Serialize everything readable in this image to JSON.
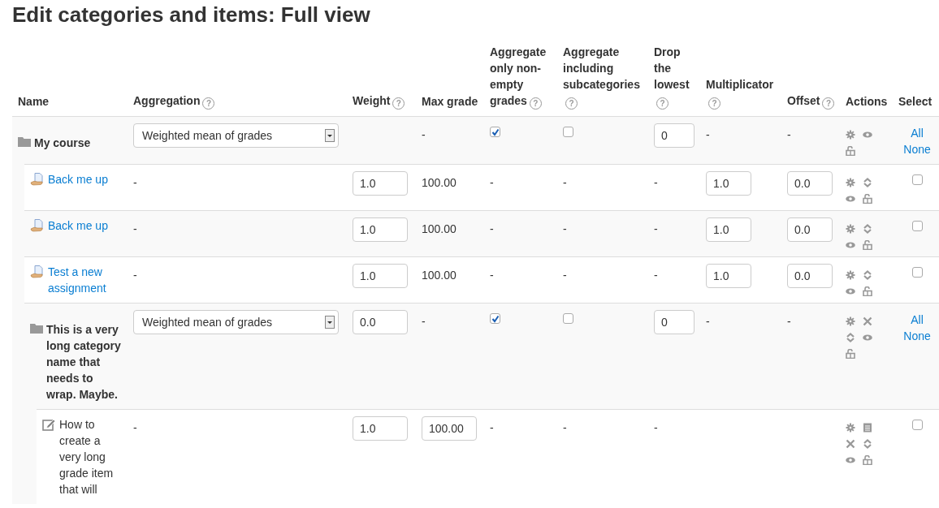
{
  "title": "Edit categories and items: Full view",
  "columns": [
    {
      "label": "Name"
    },
    {
      "label": "Aggregation",
      "help": "?"
    },
    {
      "label": "Weight",
      "help": "?"
    },
    {
      "label": "Max grade"
    },
    {
      "label": "Aggregate only non-empty grades",
      "help": "?"
    },
    {
      "label": "Aggregate including subcategories",
      "help": "?"
    },
    {
      "label": "Drop the lowest",
      "help": "?"
    },
    {
      "label": "Multiplicator",
      "help": "?"
    },
    {
      "label": "Offset",
      "help": "?"
    },
    {
      "label": "Actions"
    },
    {
      "label": "Select"
    }
  ],
  "rows": [
    {
      "kind": "category",
      "name": "My course",
      "cells": [
        {
          "kind": "select",
          "value": "Weighted mean of grades"
        },
        null,
        {
          "kind": "text",
          "text": "-"
        },
        {
          "kind": "checkbox",
          "checked": true
        },
        {
          "kind": "checkbox",
          "checked": false
        },
        {
          "kind": "field",
          "value": "0"
        },
        {
          "kind": "text",
          "text": "-"
        },
        {
          "kind": "text",
          "text": "-"
        }
      ],
      "actions": [
        {
          "kind": "settings"
        },
        {
          "kind": "hide"
        },
        {
          "kind": "lock"
        }
      ],
      "select": {
        "kind": "links",
        "links": [
          "All",
          "None"
        ]
      },
      "children": [
        {
          "kind": "assignment",
          "name": "Back me up",
          "cells": [
            {
              "kind": "text",
              "text": "-"
            },
            {
              "kind": "field",
              "value": "1.0"
            },
            {
              "kind": "text",
              "text": "100.00"
            },
            {
              "kind": "text",
              "text": "-"
            },
            {
              "kind": "text",
              "text": "-"
            },
            {
              "kind": "text",
              "text": "-"
            },
            {
              "kind": "field",
              "value": "1.0"
            },
            {
              "kind": "field",
              "value": "0.0"
            }
          ],
          "actions": [
            {
              "kind": "settings"
            },
            {
              "kind": "move"
            },
            {
              "kind": "hide"
            },
            {
              "kind": "lock"
            }
          ],
          "select": {
            "kind": "checkbox",
            "checked": false
          }
        },
        {
          "kind": "assignment",
          "name": "Back me up",
          "cells": [
            {
              "kind": "text",
              "text": "-"
            },
            {
              "kind": "field",
              "value": "1.0"
            },
            {
              "kind": "text",
              "text": "100.00"
            },
            {
              "kind": "text",
              "text": "-"
            },
            {
              "kind": "text",
              "text": "-"
            },
            {
              "kind": "text",
              "text": "-"
            },
            {
              "kind": "field",
              "value": "1.0"
            },
            {
              "kind": "field",
              "value": "0.0"
            }
          ],
          "actions": [
            {
              "kind": "settings"
            },
            {
              "kind": "move"
            },
            {
              "kind": "hide"
            },
            {
              "kind": "lock"
            }
          ],
          "select": {
            "kind": "checkbox",
            "checked": false
          }
        },
        {
          "kind": "assignment",
          "name": "Test a new assignment",
          "cells": [
            {
              "kind": "text",
              "text": "-"
            },
            {
              "kind": "field",
              "value": "1.0"
            },
            {
              "kind": "text",
              "text": "100.00"
            },
            {
              "kind": "text",
              "text": "-"
            },
            {
              "kind": "text",
              "text": "-"
            },
            {
              "kind": "text",
              "text": "-"
            },
            {
              "kind": "field",
              "value": "1.0"
            },
            {
              "kind": "field",
              "value": "0.0"
            }
          ],
          "actions": [
            {
              "kind": "settings"
            },
            {
              "kind": "move"
            },
            {
              "kind": "hide"
            },
            {
              "kind": "lock"
            }
          ],
          "select": {
            "kind": "checkbox",
            "checked": false
          }
        },
        {
          "kind": "category",
          "name": "This is a very long category name that needs to wrap. Maybe.",
          "cells": [
            {
              "kind": "select",
              "value": "Weighted mean of grades"
            },
            {
              "kind": "field",
              "value": "0.0"
            },
            {
              "kind": "text",
              "text": "-"
            },
            {
              "kind": "checkbox",
              "checked": true
            },
            {
              "kind": "checkbox",
              "checked": false
            },
            {
              "kind": "field",
              "value": "0"
            },
            {
              "kind": "text",
              "text": "-"
            },
            {
              "kind": "text",
              "text": "-"
            }
          ],
          "actions": [
            {
              "kind": "settings"
            },
            {
              "kind": "delete"
            },
            {
              "kind": "move"
            },
            {
              "kind": "hide"
            },
            {
              "kind": "lock"
            }
          ],
          "select": {
            "kind": "links",
            "links": [
              "All",
              "None"
            ]
          },
          "children": [
            {
              "kind": "manual",
              "name": "How to create a very long grade item that will",
              "cells": [
                {
                  "kind": "text",
                  "text": "-"
                },
                {
                  "kind": "field",
                  "value": "1.0"
                },
                {
                  "kind": "field",
                  "value": "100.00"
                },
                {
                  "kind": "text",
                  "text": "-"
                },
                {
                  "kind": "text",
                  "text": "-"
                },
                {
                  "kind": "text",
                  "text": "-"
                },
                null,
                null
              ],
              "actions": [
                {
                  "kind": "settings"
                },
                {
                  "kind": "report"
                },
                {
                  "kind": "delete"
                },
                {
                  "kind": "move"
                },
                {
                  "kind": "hide"
                },
                {
                  "kind": "lock"
                }
              ],
              "select": {
                "kind": "checkbox",
                "checked": false
              }
            }
          ]
        }
      ]
    }
  ]
}
